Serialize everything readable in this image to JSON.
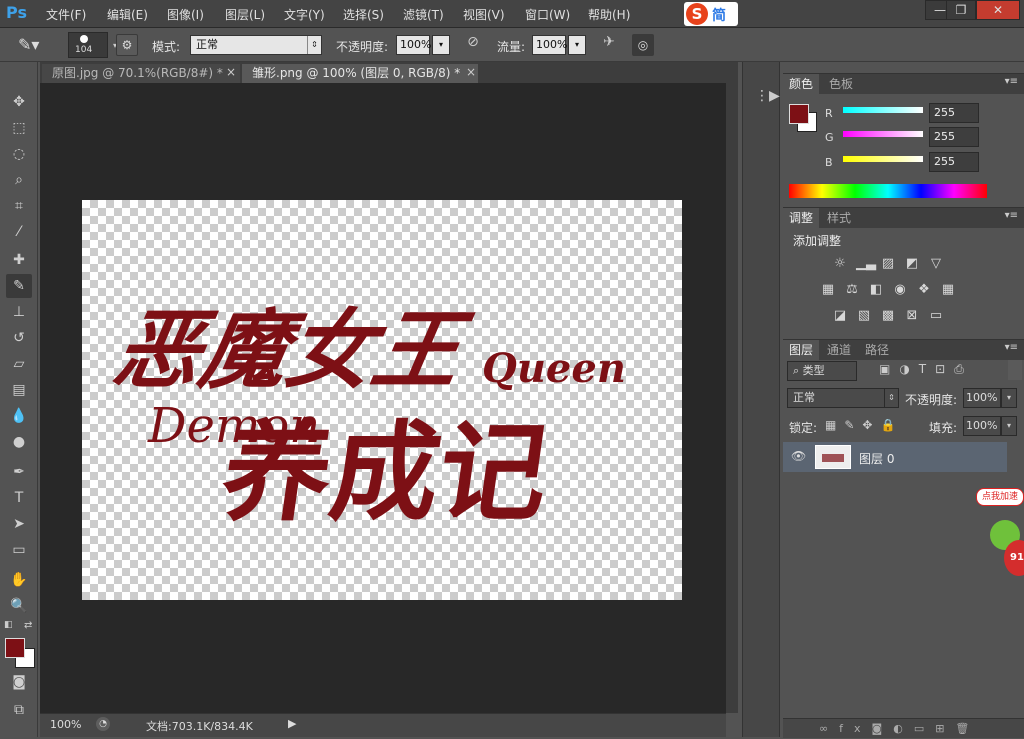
{
  "app": {
    "logo": "Ps"
  },
  "menu": [
    "文件(F)",
    "编辑(E)",
    "图像(I)",
    "图层(L)",
    "文字(Y)",
    "选择(S)",
    "滤镜(T)",
    "视图(V)",
    "窗口(W)",
    "帮助(H)"
  ],
  "ime": {
    "logo": "S",
    "label": "简"
  },
  "window_controls": {
    "minimize": "—",
    "restore": "❐",
    "close": "✕"
  },
  "options": {
    "brush_size": "104",
    "mode_label": "模式:",
    "mode_value": "正常",
    "opacity_label": "不透明度:",
    "opacity_value": "100%",
    "flow_label": "流量:",
    "flow_value": "100%"
  },
  "tabs": [
    {
      "label": "原图.jpg @ 70.1%(RGB/8#) *",
      "close": "×"
    },
    {
      "label": "雏形.png @ 100% (图层 0, RGB/8) *",
      "close": "×"
    }
  ],
  "artwork": {
    "chinese": "恶魔女王",
    "english": "Demon",
    "queen": "Queen",
    "lower": "养成记",
    "color": "#7d1015"
  },
  "status": {
    "zoom": "100%",
    "doc_info": "文档:703.1K/834.4K"
  },
  "color_panel": {
    "tabs": [
      "颜色",
      "色板"
    ],
    "channels": [
      {
        "label": "R",
        "value": "255"
      },
      {
        "label": "G",
        "value": "255"
      },
      {
        "label": "B",
        "value": "255"
      }
    ],
    "fg_color": "#7d1015",
    "bg_color": "#ffffff"
  },
  "adjust_panel": {
    "tabs": [
      "调整",
      "样式"
    ],
    "title": "添加调整"
  },
  "layers_panel": {
    "tabs": [
      "图层",
      "通道",
      "路径"
    ],
    "filter_kind": "类型",
    "blend_mode": "正常",
    "opacity_label": "不透明度:",
    "opacity_value": "100%",
    "lock_label": "锁定:",
    "fill_label": "填充:",
    "fill_value": "100%",
    "layers": [
      {
        "name": "图层 0"
      }
    ]
  },
  "ad": {
    "label": "点我加速",
    "number": "91"
  }
}
